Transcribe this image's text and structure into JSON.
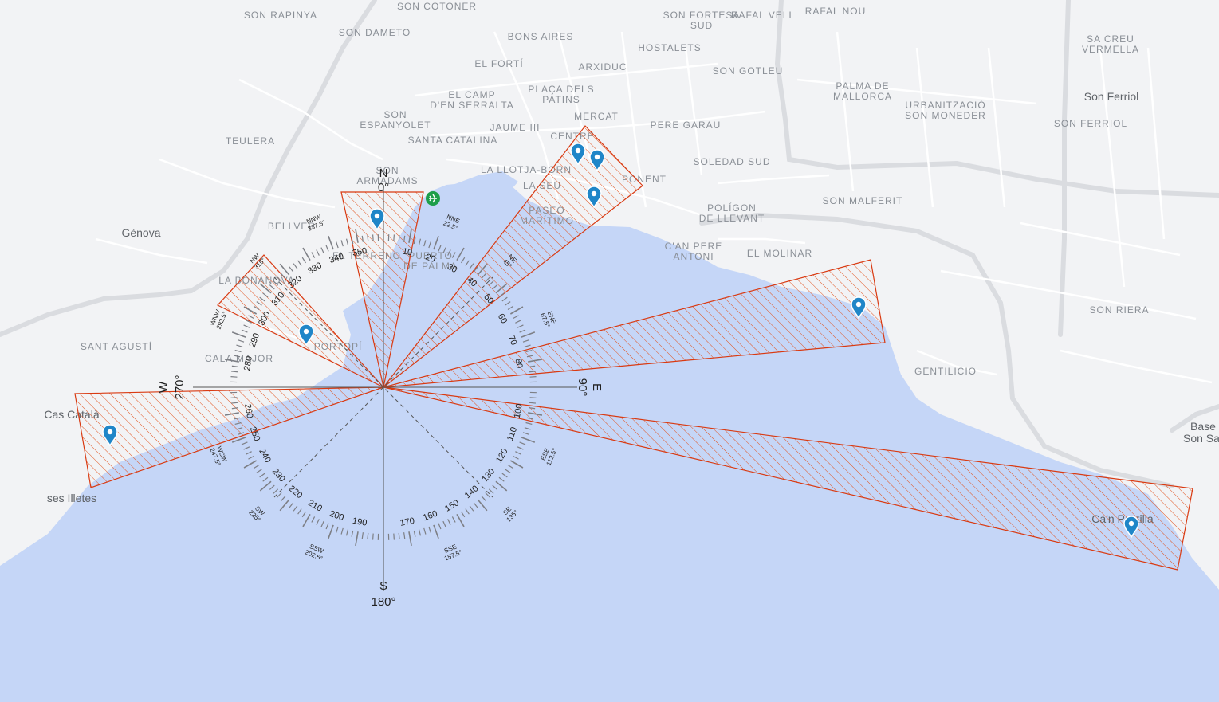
{
  "map": {
    "colors": {
      "land": "#f2f3f5",
      "sea": "#c5d6f7",
      "road": "#ffffff",
      "highway": "#dadce0",
      "sector_stroke": "#d93a12",
      "pin": "#1f86c8",
      "compass": "#7d7f85",
      "site_marker": "#1e9e4a"
    },
    "district_labels": [
      "SON RAPINYA",
      "SON COTONER",
      "SON FORTESA SUD",
      "RAFAL VELL",
      "RAFAL NOU",
      "SON DAMETO",
      "BONS AIRES",
      "HOSTALETS",
      "SA CREU VERMELLA",
      "EL FORTÍ",
      "ARXIDUC",
      "SON GOTLEU",
      "PALMA DE MALLORCA",
      "PLAÇA DELS PATINS",
      "EL CAMP D'EN SERRALTA",
      "URBANITZACIÓ SON MONEDER",
      "SON FERRIOL",
      "MERCAT",
      "SON ESPANYOLET",
      "JAUME III",
      "PERE GARAU",
      "TEULERA",
      "SANTA CATALINA",
      "CENTRE",
      "SON ARMADAMS",
      "LA LLOTJA-BORN",
      "SOLEDAD SUD",
      "LA SEU",
      "PONENT",
      "SON MALFERIT",
      "PASEO MARÍTIMO",
      "POLÍGON DE LLEVANT",
      "BELLVER",
      "C'AN PERE ANTONI",
      "EL MOLINAR",
      "EL TERRENO",
      "PUERTO DE PALMA",
      "LA BONANOVA",
      "SON RIERA",
      "PORTOPÍ",
      "SANT AGUSTÍ",
      "CALA MAJOR",
      "GENTILICIO"
    ],
    "place_labels": [
      "Gènova",
      "Son Ferriol",
      "Cas Català",
      "ses Illetes",
      "Ca'n Pastilla",
      "Base Son Sant"
    ],
    "pins": [
      {
        "name": "pin-1"
      },
      {
        "name": "pin-2"
      },
      {
        "name": "pin-3"
      },
      {
        "name": "pin-4"
      },
      {
        "name": "pin-5"
      },
      {
        "name": "pin-6"
      },
      {
        "name": "pin-7"
      },
      {
        "name": "pin-8"
      }
    ]
  },
  "compass": {
    "cardinals": {
      "N": {
        "letter": "N",
        "deg": "0°"
      },
      "E": {
        "letter": "E",
        "deg": "90°"
      },
      "S": {
        "letter": "S",
        "deg": "180°"
      },
      "W": {
        "letter": "W",
        "deg": "270°"
      }
    },
    "degree_ticks": [
      "10",
      "20",
      "30",
      "40",
      "50",
      "60",
      "70",
      "80",
      "100",
      "110",
      "120",
      "130",
      "140",
      "150",
      "160",
      "170",
      "190",
      "200",
      "210",
      "220",
      "230",
      "240",
      "250",
      "260",
      "280",
      "290",
      "300",
      "310",
      "320",
      "330",
      "340",
      "350"
    ],
    "intercardinals": [
      {
        "abbr": "NNE",
        "deg": "22.5°"
      },
      {
        "abbr": "NE",
        "deg": "45°"
      },
      {
        "abbr": "ENE",
        "deg": "67.5°"
      },
      {
        "abbr": "ESE",
        "deg": "112.5°"
      },
      {
        "abbr": "SE",
        "deg": "135°"
      },
      {
        "abbr": "SSE",
        "deg": "157.5°"
      },
      {
        "abbr": "SSW",
        "deg": "202.5°"
      },
      {
        "abbr": "SW",
        "deg": "225°"
      },
      {
        "abbr": "WSW",
        "deg": "247.5°"
      },
      {
        "abbr": "WNW",
        "deg": "292.5°"
      },
      {
        "abbr": "NW",
        "deg": "315°"
      },
      {
        "abbr": "NNW",
        "deg": "337.5°"
      }
    ]
  },
  "sectors": [
    {
      "name": "sector-north"
    },
    {
      "name": "sector-north-east"
    },
    {
      "name": "sector-east-north-east"
    },
    {
      "name": "sector-east-south-east"
    },
    {
      "name": "sector-west-north-west"
    },
    {
      "name": "sector-west"
    }
  ]
}
